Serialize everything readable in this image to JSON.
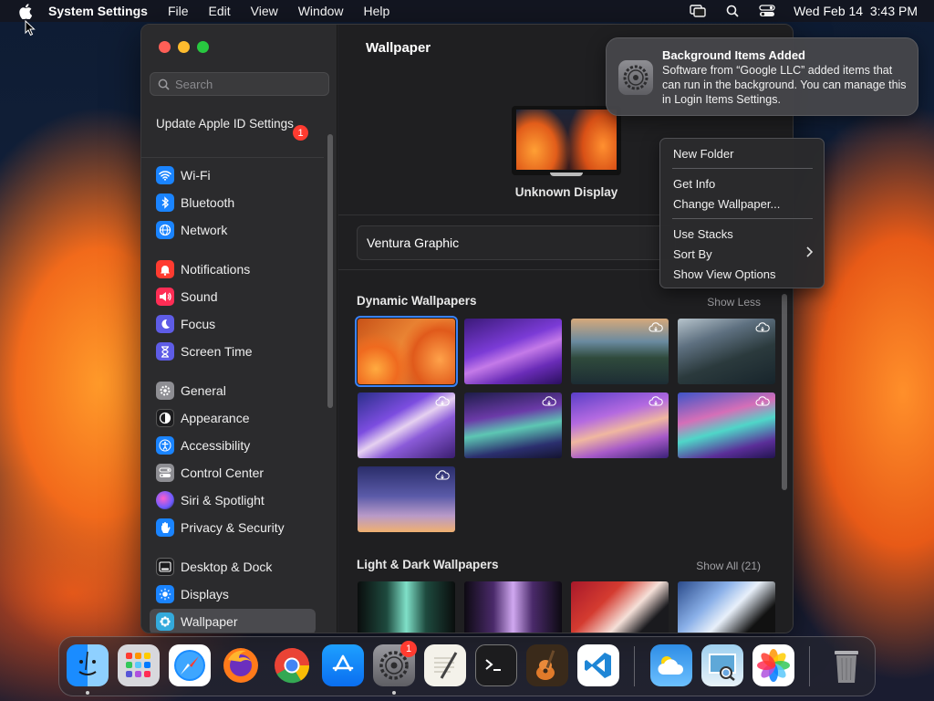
{
  "menubar": {
    "app_name": "System Settings",
    "menus": [
      "File",
      "Edit",
      "View",
      "Window",
      "Help"
    ],
    "datetime": "Wed Feb 14  3:43 PM",
    "icons": [
      "apple-icon",
      "screen-mirroring-icon",
      "spotlight-search-icon",
      "control-center-icon"
    ]
  },
  "sidebar": {
    "search_placeholder": "Search",
    "apple_id_label": "Update Apple ID Settings",
    "apple_id_badge": "1",
    "items": [
      {
        "label": "Wi-Fi",
        "icon": "wifi-icon",
        "color": "#1a84ff"
      },
      {
        "label": "Bluetooth",
        "icon": "bluetooth-icon",
        "color": "#1a84ff"
      },
      {
        "label": "Network",
        "icon": "globe-icon",
        "color": "#1a84ff"
      },
      {
        "label": "Notifications",
        "icon": "bell-icon",
        "color": "#ff3b30"
      },
      {
        "label": "Sound",
        "icon": "speaker-icon",
        "color": "#ff2d55"
      },
      {
        "label": "Focus",
        "icon": "moon-icon",
        "color": "#5e5ce6"
      },
      {
        "label": "Screen Time",
        "icon": "hourglass-icon",
        "color": "#5e5ce6"
      },
      {
        "label": "General",
        "icon": "gear-icon",
        "color": "#8e8e93"
      },
      {
        "label": "Appearance",
        "icon": "appearance-icon",
        "color": "#1c1c1e"
      },
      {
        "label": "Accessibility",
        "icon": "accessibility-icon",
        "color": "#1a84ff"
      },
      {
        "label": "Control Center",
        "icon": "control-center-icon",
        "color": "#8e8e93"
      },
      {
        "label": "Siri & Spotlight",
        "icon": "siri-icon",
        "color": "#bf5af2"
      },
      {
        "label": "Privacy & Security",
        "icon": "hand-icon",
        "color": "#1a84ff"
      },
      {
        "label": "Desktop & Dock",
        "icon": "dock-icon",
        "color": "#1c1c1e"
      },
      {
        "label": "Displays",
        "icon": "sun-icon",
        "color": "#1a84ff"
      },
      {
        "label": "Wallpaper",
        "icon": "wallpaper-icon",
        "color": "#34aadc"
      }
    ]
  },
  "main": {
    "title": "Wallpaper",
    "display_label": "Unknown Display",
    "current_wallpaper": "Ventura Graphic",
    "dynamic_title": "Dynamic Wallpapers",
    "dynamic_action": "Show Less",
    "light_dark_title": "Light & Dark Wallpapers",
    "light_dark_action": "Show All (21)"
  },
  "notification": {
    "title": "Background Items Added",
    "body": "Software from “Google LLC” added items that can run in the background. You can manage this in Login Items Settings."
  },
  "context_menu": {
    "items": [
      "New Folder",
      "Get Info",
      "Change Wallpaper...",
      "Use Stacks",
      "Sort By",
      "Show View Options"
    ]
  },
  "dock": {
    "apps": [
      "Finder",
      "Launchpad",
      "Safari",
      "Firefox",
      "Chrome",
      "App Store",
      "System Settings",
      "TextEdit",
      "Terminal",
      "GarageBand",
      "Visual Studio Code",
      "Weather",
      "Preview",
      "Photos",
      "Trash"
    ],
    "settings_badge": "1"
  }
}
